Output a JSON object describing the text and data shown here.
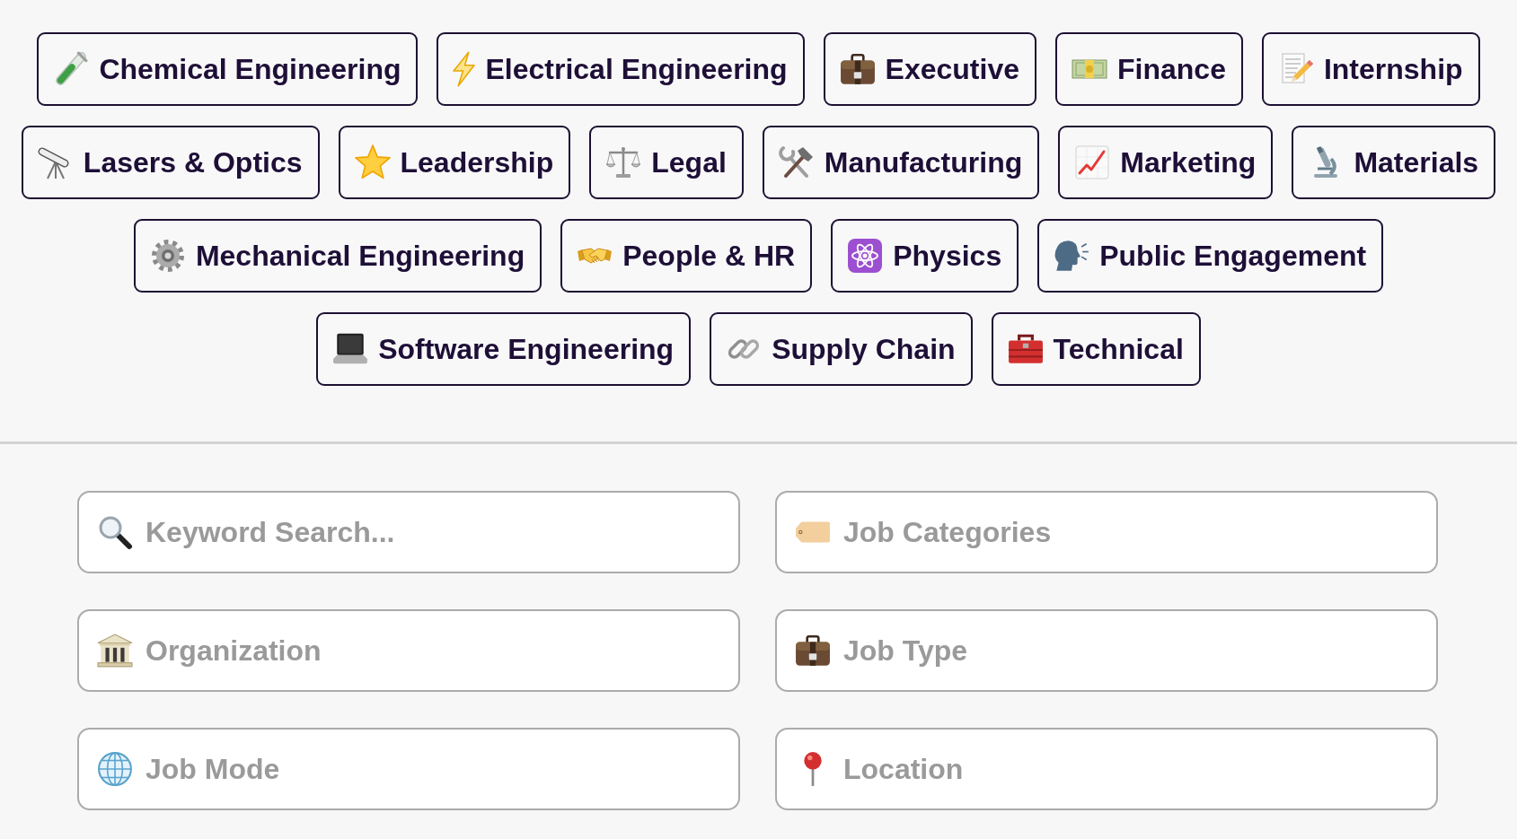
{
  "categories": [
    {
      "label": "Chemical Engineering"
    },
    {
      "label": "Electrical Engineering"
    },
    {
      "label": "Executive"
    },
    {
      "label": "Finance"
    },
    {
      "label": "Internship"
    },
    {
      "label": "Lasers & Optics"
    },
    {
      "label": "Leadership"
    },
    {
      "label": "Legal"
    },
    {
      "label": "Manufacturing"
    },
    {
      "label": "Marketing"
    },
    {
      "label": "Materials"
    },
    {
      "label": "Mechanical Engineering"
    },
    {
      "label": "People & HR"
    },
    {
      "label": "Physics"
    },
    {
      "label": "Public Engagement"
    },
    {
      "label": "Software Engineering"
    },
    {
      "label": "Supply Chain"
    },
    {
      "label": "Technical"
    }
  ],
  "filters": [
    {
      "placeholder": "Keyword Search..."
    },
    {
      "placeholder": "Job Categories"
    },
    {
      "placeholder": "Organization"
    },
    {
      "placeholder": "Job Type"
    },
    {
      "placeholder": "Job Mode"
    },
    {
      "placeholder": "Location"
    }
  ]
}
